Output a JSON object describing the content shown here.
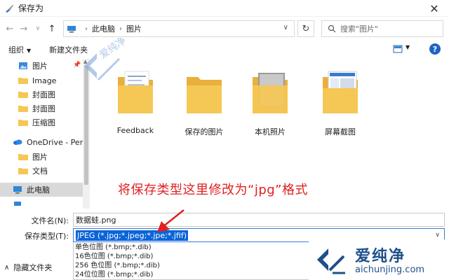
{
  "window": {
    "title": "保存为",
    "close_glyph": "✕"
  },
  "nav": {
    "back_glyph": "←",
    "forward_glyph": "→",
    "recent_glyph": "∨",
    "up_glyph": "↑"
  },
  "address": {
    "root": "此电脑",
    "folder": "图片",
    "separator": "›",
    "dropdown_glyph": "∨",
    "refresh_glyph": "↻"
  },
  "search": {
    "placeholder": "搜索\"图片\""
  },
  "toolbar": {
    "organize": "组织",
    "new_folder": "新建文件夹",
    "arrow_glyph": "▼",
    "help": "?"
  },
  "sidebar": {
    "items": [
      {
        "label": "图片",
        "icon": "pictures-icon"
      },
      {
        "label": "Image",
        "icon": "folder-icon"
      },
      {
        "label": "封面图",
        "icon": "folder-icon"
      },
      {
        "label": "封面图",
        "icon": "folder-icon"
      },
      {
        "label": "压缩图",
        "icon": "folder-icon"
      },
      {
        "label": "OneDrive - Perso",
        "icon": "onedrive-icon"
      },
      {
        "label": "图片",
        "icon": "folder-icon"
      },
      {
        "label": "文档",
        "icon": "folder-icon"
      },
      {
        "label": "此电脑",
        "icon": "pc-icon"
      }
    ]
  },
  "folders": [
    {
      "label": "Feedback"
    },
    {
      "label": "保存的图片"
    },
    {
      "label": "本机照片"
    },
    {
      "label": "屏幕截图"
    }
  ],
  "annotation": "将保存类型这里修改为“jpg”格式",
  "form": {
    "filename_label": "文件名(N):",
    "filename_value": "数据蛙.png",
    "filetype_label": "保存类型(T):",
    "filetype_value": "JPEG (*.jpg;*.jpeg;*.jpe;*.jfif)",
    "dropdown_glyph": "∨"
  },
  "filetype_options": [
    "单色位图 (*.bmp;*.dib)",
    "16色位图 (*.bmp;*.dib)",
    "256 色位图 (*.bmp;*.dib)",
    "24位位图 (*.bmp;*.dib)"
  ],
  "hide_folders": {
    "label": "隐藏文件夹",
    "chevron": "∧"
  },
  "logo": {
    "cn": "爱纯净",
    "en": "aichunjing.com"
  },
  "colors": {
    "accent": "#0a64d8",
    "annotation": "#e02020",
    "folder": "#f5c754",
    "logo": "#1e4f8a"
  }
}
